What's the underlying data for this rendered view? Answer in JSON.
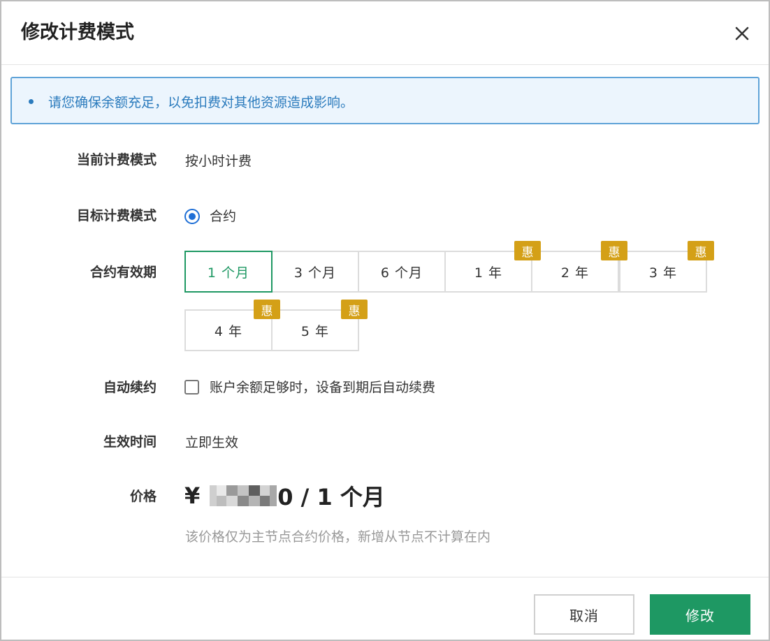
{
  "dialog": {
    "title": "修改计费模式",
    "close_icon": "close-icon"
  },
  "notice": {
    "text": "请您确保余额充足，以免扣费对其他资源造成影响。"
  },
  "form": {
    "current_mode_label": "当前计费模式",
    "current_mode_value": "按小时计费",
    "target_mode_label": "目标计费模式",
    "target_mode_option": "合约",
    "period_label": "合约有效期",
    "periods": [
      {
        "label": "1 个月",
        "badge": ""
      },
      {
        "label": "3 个月",
        "badge": ""
      },
      {
        "label": "6 个月",
        "badge": ""
      },
      {
        "label": "1 年",
        "badge": "惠"
      },
      {
        "label": "2 年",
        "badge": "惠"
      },
      {
        "label": "3 年",
        "badge": "惠"
      },
      {
        "label": "4 年",
        "badge": "惠"
      },
      {
        "label": "5 年",
        "badge": "惠"
      }
    ],
    "selected_period": "1 个月",
    "auto_renew_label": "自动续约",
    "auto_renew_text": "账户余额足够时，设备到期后自动续费",
    "auto_renew_checked": false,
    "effective_label": "生效时间",
    "effective_value": "立即生效",
    "price_label": "价格",
    "price_currency": "¥",
    "price_suffix": "0 / 1 个月",
    "price_note": "该价格仅为主节点合约价格，新增从节点不计算在内"
  },
  "footer": {
    "cancel_label": "取消",
    "confirm_label": "修改"
  },
  "colors": {
    "accent_green": "#1e9863",
    "notice_blue": "#2b7bbd",
    "badge_gold": "#d4a017",
    "radio_blue": "#1f6fd6"
  }
}
